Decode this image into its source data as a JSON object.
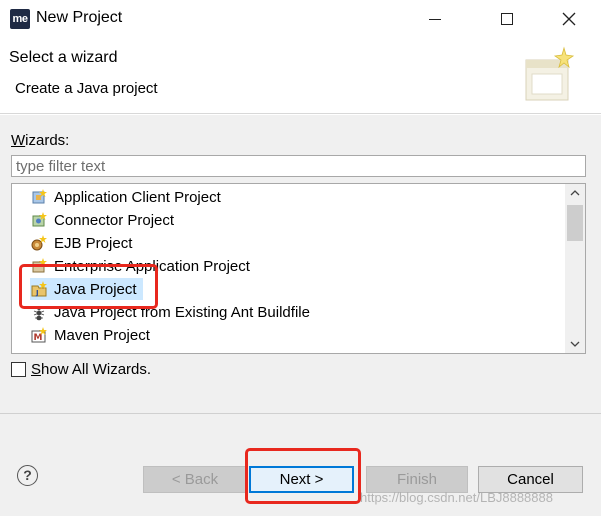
{
  "window": {
    "title": "New Project",
    "logo_text": "me"
  },
  "header": {
    "title": "Select a wizard",
    "subtitle": "Create a Java project"
  },
  "wizards": {
    "label_prefix": "W",
    "label_rest": "izards:",
    "filter_placeholder": "type filter text",
    "items": [
      {
        "label": "Application Client Project",
        "icon": "app-client-icon"
      },
      {
        "label": "Connector Project",
        "icon": "connector-icon"
      },
      {
        "label": "EJB Project",
        "icon": "ejb-icon"
      },
      {
        "label": "Enterprise Application Project",
        "icon": "ear-icon"
      },
      {
        "label": "Java Project",
        "icon": "java-project-icon",
        "selected": true
      },
      {
        "label": "Java Project from Existing Ant Buildfile",
        "icon": "ant-icon"
      },
      {
        "label": "Maven Project",
        "icon": "maven-icon"
      }
    ]
  },
  "show_all": {
    "prefix": "S",
    "rest": "how All Wizards."
  },
  "buttons": {
    "back": "< Back",
    "next": "Next >",
    "finish": "Finish",
    "cancel": "Cancel",
    "help": "?"
  },
  "watermark": "https://blog.csdn.net/LBJ8888888",
  "colors": {
    "selection": "#cce8ff",
    "highlight": "#e8281e",
    "focus": "#0078d7"
  }
}
